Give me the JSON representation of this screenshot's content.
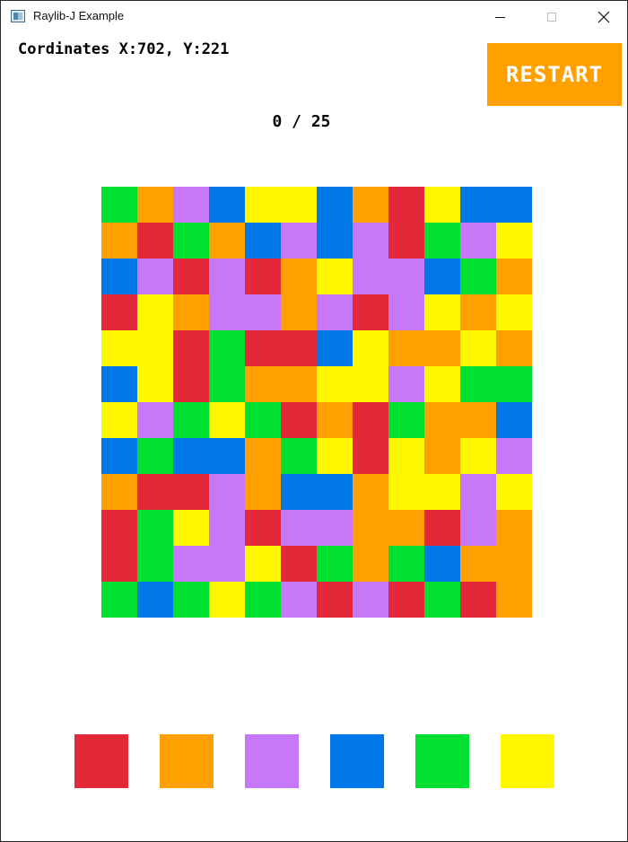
{
  "window": {
    "title": "Raylib-J Example"
  },
  "hud": {
    "coordinates": "Cordinates X:702, Y:221",
    "restart_label": "RESTART",
    "score": "0 / 25"
  },
  "colors": {
    "R": "#e32939",
    "O": "#ffa000",
    "P": "#c778f8",
    "B": "#0078e8",
    "G": "#00e030",
    "Y": "#fff700"
  },
  "palette": [
    {
      "name": "red",
      "key": "R"
    },
    {
      "name": "orange",
      "key": "O"
    },
    {
      "name": "purple",
      "key": "P"
    },
    {
      "name": "blue",
      "key": "B"
    },
    {
      "name": "green",
      "key": "G"
    },
    {
      "name": "yellow",
      "key": "Y"
    }
  ],
  "board": {
    "rows": 12,
    "cols": 12,
    "grid": [
      [
        "G",
        "O",
        "P",
        "B",
        "Y",
        "Y",
        "B",
        "O",
        "R",
        "Y",
        "B",
        "B"
      ],
      [
        "O",
        "R",
        "G",
        "O",
        "B",
        "P",
        "B",
        "P",
        "R",
        "G",
        "P",
        "Y"
      ],
      [
        "B",
        "P",
        "R",
        "P",
        "R",
        "O",
        "Y",
        "P",
        "P",
        "B",
        "G",
        "O"
      ],
      [
        "R",
        "Y",
        "O",
        "P",
        "P",
        "O",
        "P",
        "R",
        "P",
        "Y",
        "O",
        "Y"
      ],
      [
        "Y",
        "Y",
        "R",
        "G",
        "R",
        "R",
        "B",
        "Y",
        "O",
        "O",
        "Y",
        "O"
      ],
      [
        "B",
        "Y",
        "R",
        "G",
        "O",
        "O",
        "Y",
        "Y",
        "P",
        "Y",
        "G",
        "G"
      ],
      [
        "Y",
        "P",
        "G",
        "Y",
        "G",
        "R",
        "O",
        "R",
        "G",
        "O",
        "O",
        "B"
      ],
      [
        "B",
        "G",
        "B",
        "B",
        "O",
        "G",
        "Y",
        "R",
        "Y",
        "O",
        "Y",
        "P"
      ],
      [
        "O",
        "R",
        "R",
        "P",
        "O",
        "B",
        "B",
        "O",
        "Y",
        "Y",
        "P",
        "Y"
      ],
      [
        "R",
        "G",
        "Y",
        "P",
        "R",
        "P",
        "P",
        "O",
        "O",
        "R",
        "P",
        "O"
      ],
      [
        "R",
        "G",
        "P",
        "P",
        "Y",
        "R",
        "G",
        "O",
        "G",
        "B",
        "O",
        "O"
      ],
      [
        "G",
        "B",
        "G",
        "Y",
        "G",
        "P",
        "R",
        "P",
        "R",
        "G",
        "R",
        "O"
      ]
    ]
  }
}
